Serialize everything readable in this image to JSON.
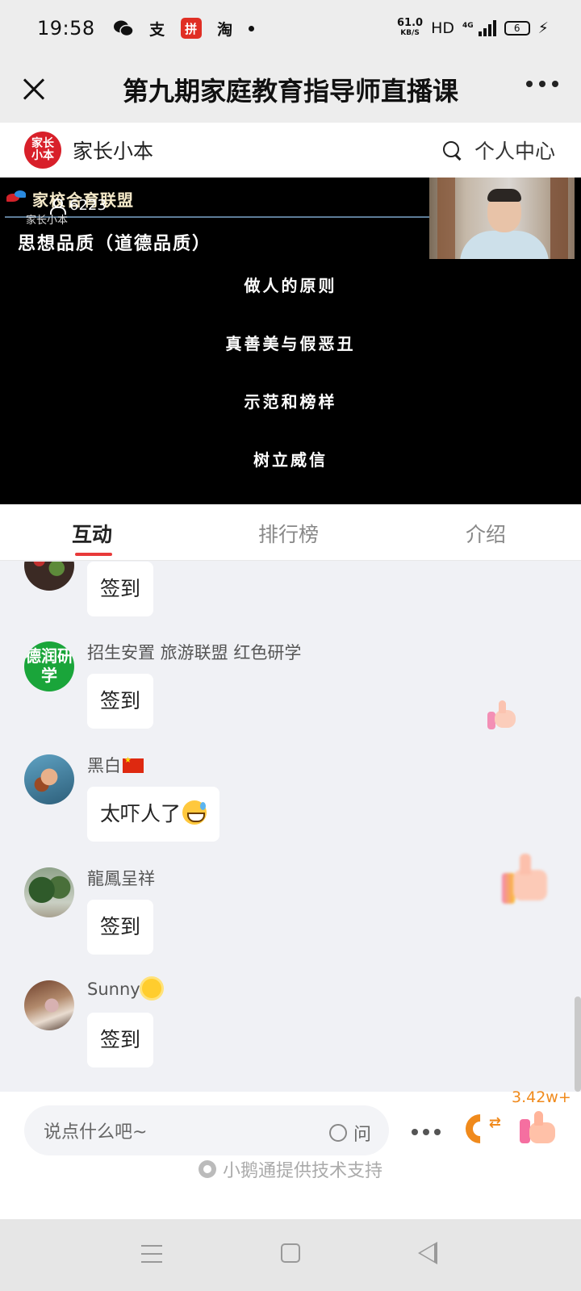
{
  "status_bar": {
    "time": "19:58",
    "apps": [
      "wechat-icon",
      "alipay-icon",
      "pinduoduo-icon",
      "taobao-icon"
    ],
    "alipay_glyph": "支",
    "pinduoduo_glyph": "拼",
    "taobao_glyph": "淘",
    "net_speed": "61.0",
    "net_speed_unit": "KB/S",
    "hd_label": "HD",
    "network_type": "4G",
    "battery": "6"
  },
  "title_bar": {
    "title": "第九期家庭教育指导师直播课"
  },
  "brand": {
    "logo_text": "家长小本",
    "name": "家长小本",
    "personal_center": "个人中心"
  },
  "video": {
    "overlay_logo": "家校合育联盟",
    "overlay_sub": "家长小本",
    "viewer_count": "6223",
    "heading": "思想品质（道德品质）",
    "lines": [
      "做人的原则",
      "真善美与假恶丑",
      "示范和榜样",
      "树立威信"
    ]
  },
  "tabs": [
    {
      "label": "互动",
      "active": true
    },
    {
      "label": "排行榜",
      "active": false
    },
    {
      "label": "介绍",
      "active": false
    }
  ],
  "messages": [
    {
      "name": "",
      "text": "签到"
    },
    {
      "name": "招生安置 旅游联盟 红色研学",
      "avatar_text": "德润研学",
      "text": "签到"
    },
    {
      "name": "黑白",
      "text": "太吓人了"
    },
    {
      "name": "龍鳳呈祥",
      "text": "签到"
    },
    {
      "name": "Sunny",
      "text": "签到"
    }
  ],
  "input": {
    "placeholder": "说点什么吧~",
    "ask_label": "问",
    "like_count": "3.42w+"
  },
  "support_text": "小鹅通提供技术支持",
  "colors": {
    "accent_red": "#e83a3a",
    "brand_red": "#d8202a",
    "orange": "#f08a1c"
  }
}
